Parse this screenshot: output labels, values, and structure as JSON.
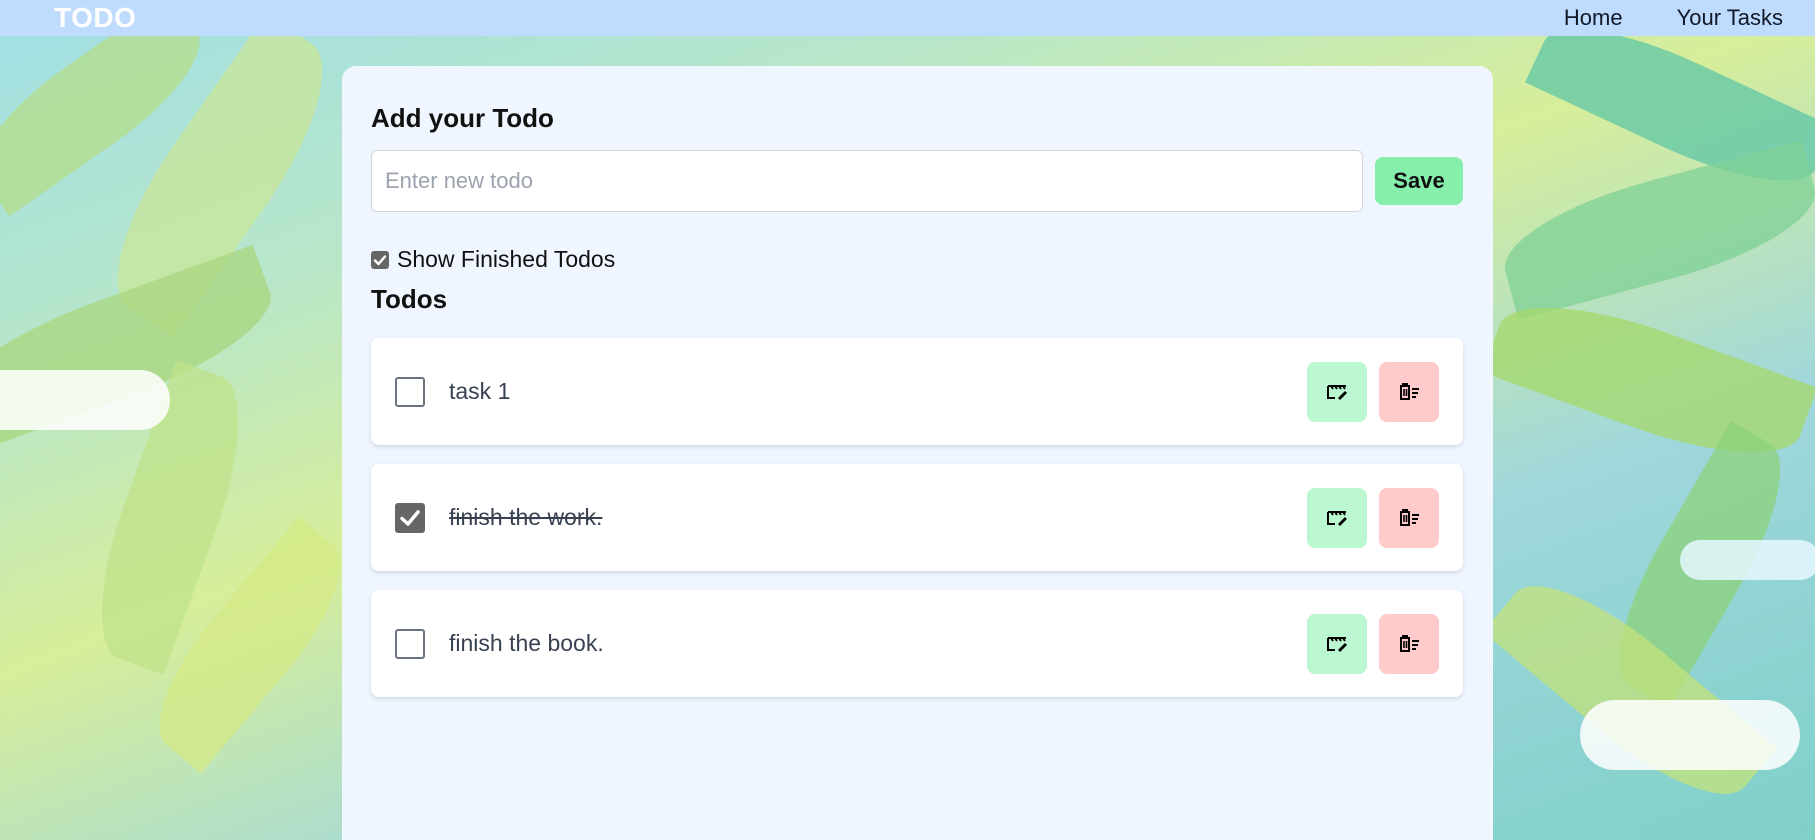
{
  "nav": {
    "logo": "TODO",
    "links": [
      "Home",
      "Your Tasks"
    ]
  },
  "form": {
    "heading": "Add your Todo",
    "input_placeholder": "Enter new todo",
    "input_value": "",
    "save_label": "Save"
  },
  "filter": {
    "show_finished_label": "Show Finished Todos",
    "show_finished_checked": true
  },
  "todos_title": "Todos",
  "todos": [
    {
      "text": "task 1",
      "done": false
    },
    {
      "text": "finish the work.",
      "done": true
    },
    {
      "text": "finish the book.",
      "done": false
    }
  ],
  "icons": {
    "edit": "edit-icon",
    "delete": "delete-icon",
    "check": "check-icon"
  },
  "colors": {
    "navbar": "#bfdbfe",
    "card": "#eff6ff",
    "save": "#86efac",
    "edit": "#bbf7d0",
    "delete": "#fecaca"
  }
}
